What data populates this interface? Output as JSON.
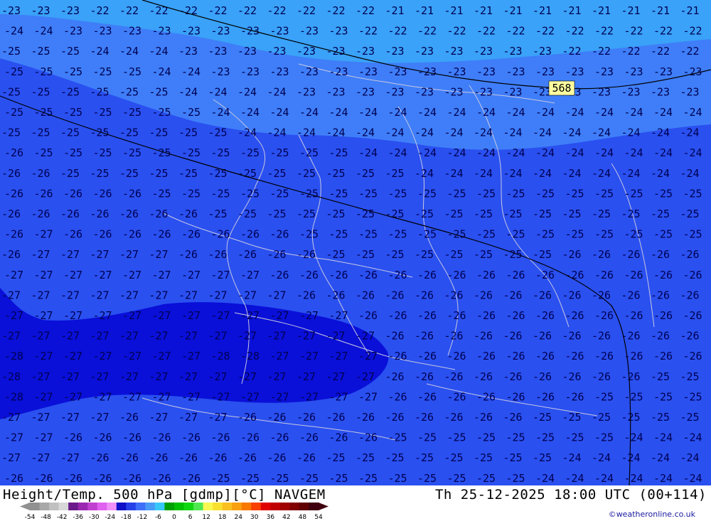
{
  "map": {
    "title": "Height/Temp. 500 hPa [gdmp][°C] NAVGEM",
    "valid_time": "Th 25-12-2025 18:00 UTC (00+114)",
    "credit": "©weatheronline.co.uk",
    "height_contour_label": "568",
    "colors": {
      "band_minus28": "#0a10d8",
      "band_minus26": "#2a50f0",
      "band_minus24": "#3f7ef8",
      "band_minus22": "#3aa2f8",
      "contour_line": "#000000",
      "label_text": "#000050",
      "border_lines": "#c8c8e0"
    },
    "temperature_labels": [
      {
        "row": 0,
        "values": [
          "-23",
          "-23",
          "-23",
          "-22",
          "-22",
          "-22",
          "-22",
          "-22",
          "-22",
          "-22",
          "-22",
          "-22",
          "-22",
          "-21",
          "-21",
          "-21",
          "-21",
          "-21",
          "-21",
          "-21",
          "-21",
          "-21",
          "-21",
          "-21",
          "-22"
        ]
      },
      {
        "row": 1,
        "values": [
          "-24",
          "-24",
          "-23",
          "-23",
          "-23",
          "-23",
          "-23",
          "-23",
          "-23",
          "-23",
          "-23",
          "-23",
          "-22",
          "-22",
          "-22",
          "-22",
          "-22",
          "-22",
          "-22",
          "-22",
          "-22",
          "-22",
          "-22",
          "-22",
          "-22"
        ]
      },
      {
        "row": 2,
        "values": [
          "-25",
          "-25",
          "-25",
          "-24",
          "-24",
          "-24",
          "-23",
          "-23",
          "-23",
          "-23",
          "-23",
          "-23",
          "-23",
          "-23",
          "-23",
          "-23",
          "-23",
          "-23",
          "-23",
          "-22",
          "-22",
          "-22",
          "-22",
          "-22",
          "-23"
        ]
      },
      {
        "row": 3,
        "values": [
          "-25",
          "-25",
          "-25",
          "-25",
          "-25",
          "-24",
          "-24",
          "-23",
          "-23",
          "-23",
          "-23",
          "-23",
          "-23",
          "-23",
          "-23",
          "-23",
          "-23",
          "-23",
          "-23",
          "-23",
          "-23",
          "-23",
          "-23",
          "-23",
          "-23"
        ]
      },
      {
        "row": 4,
        "values": [
          "-25",
          "-25",
          "-25",
          "-25",
          "-25",
          "-25",
          "-24",
          "-24",
          "-24",
          "-24",
          "-23",
          "-23",
          "-23",
          "-23",
          "-23",
          "-23",
          "-23",
          "-23",
          "-23",
          "-23",
          "-23",
          "-23",
          "-23",
          "-23",
          "-23"
        ]
      },
      {
        "row": 5,
        "values": [
          "-25",
          "-25",
          "-25",
          "-25",
          "-25",
          "-25",
          "-25",
          "-24",
          "-24",
          "-24",
          "-24",
          "-24",
          "-24",
          "-24",
          "-24",
          "-24",
          "-24",
          "-24",
          "-24",
          "-24",
          "-24",
          "-24",
          "-24",
          "-24",
          "-24"
        ]
      },
      {
        "row": 6,
        "values": [
          "-25",
          "-25",
          "-25",
          "-25",
          "-25",
          "-25",
          "-25",
          "-25",
          "-24",
          "-24",
          "-24",
          "-24",
          "-24",
          "-24",
          "-24",
          "-24",
          "-24",
          "-24",
          "-24",
          "-24",
          "-24",
          "-24",
          "-24",
          "-24",
          "-24"
        ]
      },
      {
        "row": 7,
        "values": [
          "-26",
          "-25",
          "-25",
          "-25",
          "-25",
          "-25",
          "-25",
          "-25",
          "-25",
          "-25",
          "-25",
          "-25",
          "-24",
          "-24",
          "-24",
          "-24",
          "-24",
          "-24",
          "-24",
          "-24",
          "-24",
          "-24",
          "-24",
          "-24",
          "-24"
        ]
      },
      {
        "row": 8,
        "values": [
          "-26",
          "-26",
          "-25",
          "-25",
          "-25",
          "-25",
          "-25",
          "-25",
          "-25",
          "-25",
          "-25",
          "-25",
          "-25",
          "-25",
          "-24",
          "-24",
          "-24",
          "-24",
          "-24",
          "-24",
          "-24",
          "-24",
          "-24",
          "-24",
          "-24"
        ]
      },
      {
        "row": 9,
        "values": [
          "-26",
          "-26",
          "-26",
          "-26",
          "-26",
          "-25",
          "-25",
          "-25",
          "-25",
          "-25",
          "-25",
          "-25",
          "-25",
          "-25",
          "-25",
          "-25",
          "-25",
          "-25",
          "-25",
          "-25",
          "-25",
          "-25",
          "-25",
          "-25",
          "-25"
        ]
      },
      {
        "row": 10,
        "values": [
          "-26",
          "-26",
          "-26",
          "-26",
          "-26",
          "-26",
          "-26",
          "-25",
          "-25",
          "-25",
          "-25",
          "-25",
          "-25",
          "-25",
          "-25",
          "-25",
          "-25",
          "-25",
          "-25",
          "-25",
          "-25",
          "-25",
          "-25",
          "-25",
          "-25"
        ]
      },
      {
        "row": 11,
        "values": [
          "-26",
          "-27",
          "-26",
          "-26",
          "-26",
          "-26",
          "-26",
          "-26",
          "-26",
          "-26",
          "-25",
          "-25",
          "-25",
          "-25",
          "-25",
          "-25",
          "-25",
          "-25",
          "-25",
          "-25",
          "-25",
          "-25",
          "-25",
          "-25",
          "-25"
        ]
      },
      {
        "row": 12,
        "values": [
          "-26",
          "-27",
          "-27",
          "-27",
          "-27",
          "-27",
          "-26",
          "-26",
          "-26",
          "-26",
          "-26",
          "-25",
          "-25",
          "-25",
          "-25",
          "-25",
          "-25",
          "-25",
          "-25",
          "-26",
          "-26",
          "-26",
          "-26",
          "-26",
          "-26"
        ]
      },
      {
        "row": 13,
        "values": [
          "-27",
          "-27",
          "-27",
          "-27",
          "-27",
          "-27",
          "-27",
          "-27",
          "-27",
          "-26",
          "-26",
          "-26",
          "-26",
          "-26",
          "-26",
          "-26",
          "-26",
          "-26",
          "-26",
          "-26",
          "-26",
          "-26",
          "-26",
          "-26",
          "-26"
        ]
      },
      {
        "row": 14,
        "values": [
          "-27",
          "-27",
          "-27",
          "-27",
          "-27",
          "-27",
          "-27",
          "-27",
          "-27",
          "-27",
          "-26",
          "-26",
          "-26",
          "-26",
          "-26",
          "-26",
          "-26",
          "-26",
          "-26",
          "-26",
          "-26",
          "-26",
          "-26",
          "-26",
          "-26"
        ]
      },
      {
        "row": 15,
        "values": [
          "-27",
          "-27",
          "-27",
          "-27",
          "-27",
          "-27",
          "-27",
          "-27",
          "-27",
          "-27",
          "-27",
          "-27",
          "-26",
          "-26",
          "-26",
          "-26",
          "-26",
          "-26",
          "-26",
          "-26",
          "-26",
          "-26",
          "-26",
          "-26",
          "-26"
        ]
      },
      {
        "row": 16,
        "values": [
          "-27",
          "-27",
          "-27",
          "-27",
          "-27",
          "-27",
          "-27",
          "-27",
          "-27",
          "-27",
          "-27",
          "-27",
          "-27",
          "-26",
          "-26",
          "-26",
          "-26",
          "-26",
          "-26",
          "-26",
          "-26",
          "-26",
          "-26",
          "-26",
          "-26"
        ]
      },
      {
        "row": 17,
        "values": [
          "-28",
          "-27",
          "-27",
          "-27",
          "-27",
          "-27",
          "-27",
          "-28",
          "-28",
          "-27",
          "-27",
          "-27",
          "-27",
          "-26",
          "-26",
          "-26",
          "-26",
          "-26",
          "-26",
          "-26",
          "-26",
          "-26",
          "-26",
          "-26",
          "-25"
        ]
      },
      {
        "row": 18,
        "values": [
          "-28",
          "-27",
          "-27",
          "-27",
          "-27",
          "-27",
          "-27",
          "-27",
          "-27",
          "-27",
          "-27",
          "-27",
          "-27",
          "-26",
          "-26",
          "-26",
          "-26",
          "-26",
          "-26",
          "-26",
          "-26",
          "-26",
          "-25",
          "-25",
          "-25"
        ]
      },
      {
        "row": 19,
        "values": [
          "-28",
          "-27",
          "-27",
          "-27",
          "-27",
          "-27",
          "-27",
          "-27",
          "-27",
          "-27",
          "-27",
          "-27",
          "-27",
          "-26",
          "-26",
          "-26",
          "-26",
          "-26",
          "-26",
          "-26",
          "-25",
          "-25",
          "-25",
          "-25",
          "-25"
        ]
      },
      {
        "row": 20,
        "values": [
          "-27",
          "-27",
          "-27",
          "-27",
          "-26",
          "-27",
          "-27",
          "-27",
          "-26",
          "-26",
          "-26",
          "-26",
          "-26",
          "-26",
          "-26",
          "-26",
          "-26",
          "-26",
          "-25",
          "-25",
          "-25",
          "-25",
          "-25",
          "-25",
          "-25"
        ]
      },
      {
        "row": 21,
        "values": [
          "-27",
          "-27",
          "-26",
          "-26",
          "-26",
          "-26",
          "-26",
          "-26",
          "-26",
          "-26",
          "-26",
          "-26",
          "-26",
          "-25",
          "-25",
          "-25",
          "-25",
          "-25",
          "-25",
          "-25",
          "-25",
          "-24",
          "-24",
          "-24",
          "-24"
        ]
      },
      {
        "row": 22,
        "values": [
          "-27",
          "-27",
          "-27",
          "-26",
          "-26",
          "-26",
          "-26",
          "-26",
          "-26",
          "-26",
          "-26",
          "-25",
          "-25",
          "-25",
          "-25",
          "-25",
          "-25",
          "-25",
          "-25",
          "-24",
          "-24",
          "-24",
          "-24",
          "-24",
          "-24"
        ]
      },
      {
        "row": 23,
        "values": [
          "-26",
          "-26",
          "-26",
          "-26",
          "-26",
          "-26",
          "-26",
          "-25",
          "-25",
          "-25",
          "-25",
          "-25",
          "-25",
          "-25",
          "-25",
          "-25",
          "-25",
          "-25",
          "-24",
          "-24",
          "-24",
          "-24",
          "-24",
          "-24",
          "-23"
        ]
      }
    ]
  },
  "legend": {
    "tick_labels": [
      "-54",
      "-48",
      "-42",
      "-36",
      "-30",
      "-24",
      "-18",
      "-12",
      "-6",
      "0",
      "6",
      "12",
      "18",
      "24",
      "30",
      "36",
      "42",
      "48",
      "54"
    ],
    "swatches": [
      "#909090",
      "#a8a8a8",
      "#c0c0c0",
      "#d8d8d8",
      "#6a1a8a",
      "#9a28b0",
      "#c040d0",
      "#e060f0",
      "#f090f8",
      "#1010c8",
      "#2840e8",
      "#3f6ef8",
      "#4a9af8",
      "#38c8f8",
      "#00a000",
      "#00c000",
      "#10d810",
      "#50e850",
      "#f8f850",
      "#f8e030",
      "#f8c020",
      "#f8a010",
      "#f87800",
      "#f84000",
      "#e00000",
      "#c00000",
      "#a00000",
      "#800000",
      "#600000",
      "#400010"
    ]
  }
}
